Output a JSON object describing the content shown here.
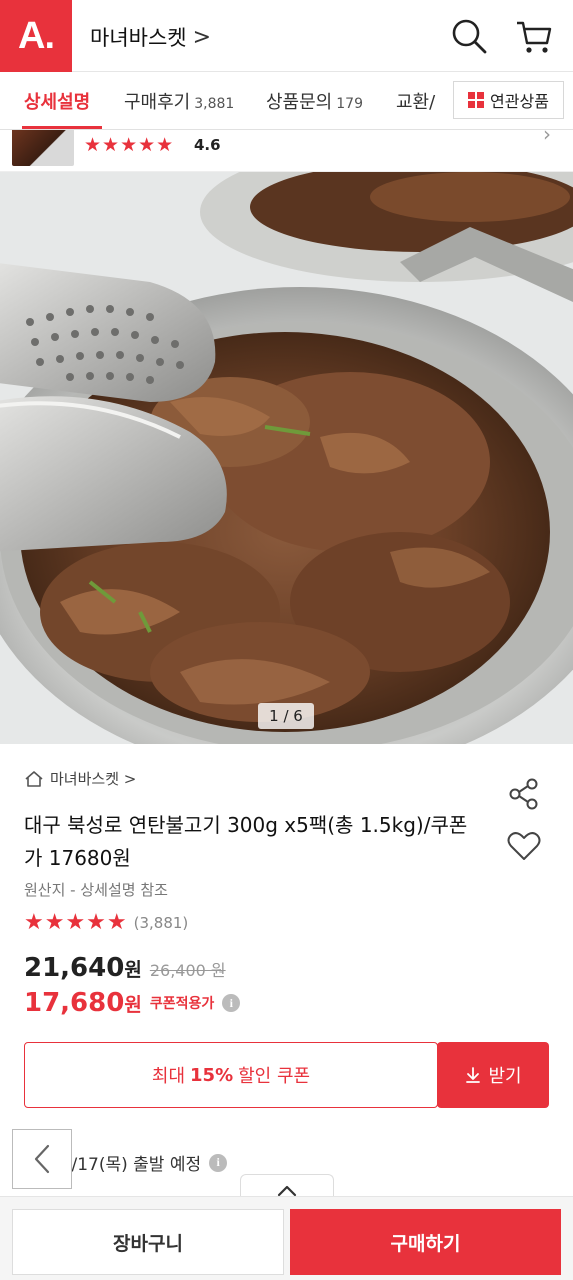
{
  "header": {
    "logo_text": "A.",
    "store_title": "마녀바스켓",
    "title_chevron": ">"
  },
  "tabs": [
    {
      "label": "상세설명",
      "count": ""
    },
    {
      "label": "구매후기",
      "count": "3,881"
    },
    {
      "label": "상품문의",
      "count": "179"
    },
    {
      "label": "교환/",
      "count": ""
    }
  ],
  "related_button": {
    "label": "연관상품"
  },
  "mini_bar": {
    "stars": "★★★★★",
    "rating": "4.6",
    "chevron": "›"
  },
  "gallery": {
    "pager": "1 / 6"
  },
  "product": {
    "store_link": "마녀바스켓 >",
    "name": "대구 북성로 연탄불고기 300g x5팩(총 1.5kg)/쿠폰가 17680원",
    "origin": "원산지 - 상세설명 참조",
    "stars": "★★★★★",
    "review_count": "(3,881)",
    "price": "21,640",
    "price_unit": "원",
    "original_price": "26,400 원",
    "coupon_price": "17,680",
    "coupon_price_unit": "원",
    "coupon_label": "쿠폰적용가",
    "info_glyph": "i"
  },
  "coupon": {
    "prefix": "최대",
    "percent": "15%",
    "suffix": "할인 쿠폰",
    "get_label": "받기"
  },
  "delivery": {
    "text": "내일 4/17(목) 출발 예정"
  },
  "bottom": {
    "cart_label": "장바구니",
    "buy_label": "구매하기"
  },
  "colors": {
    "accent": "#e8323c"
  }
}
